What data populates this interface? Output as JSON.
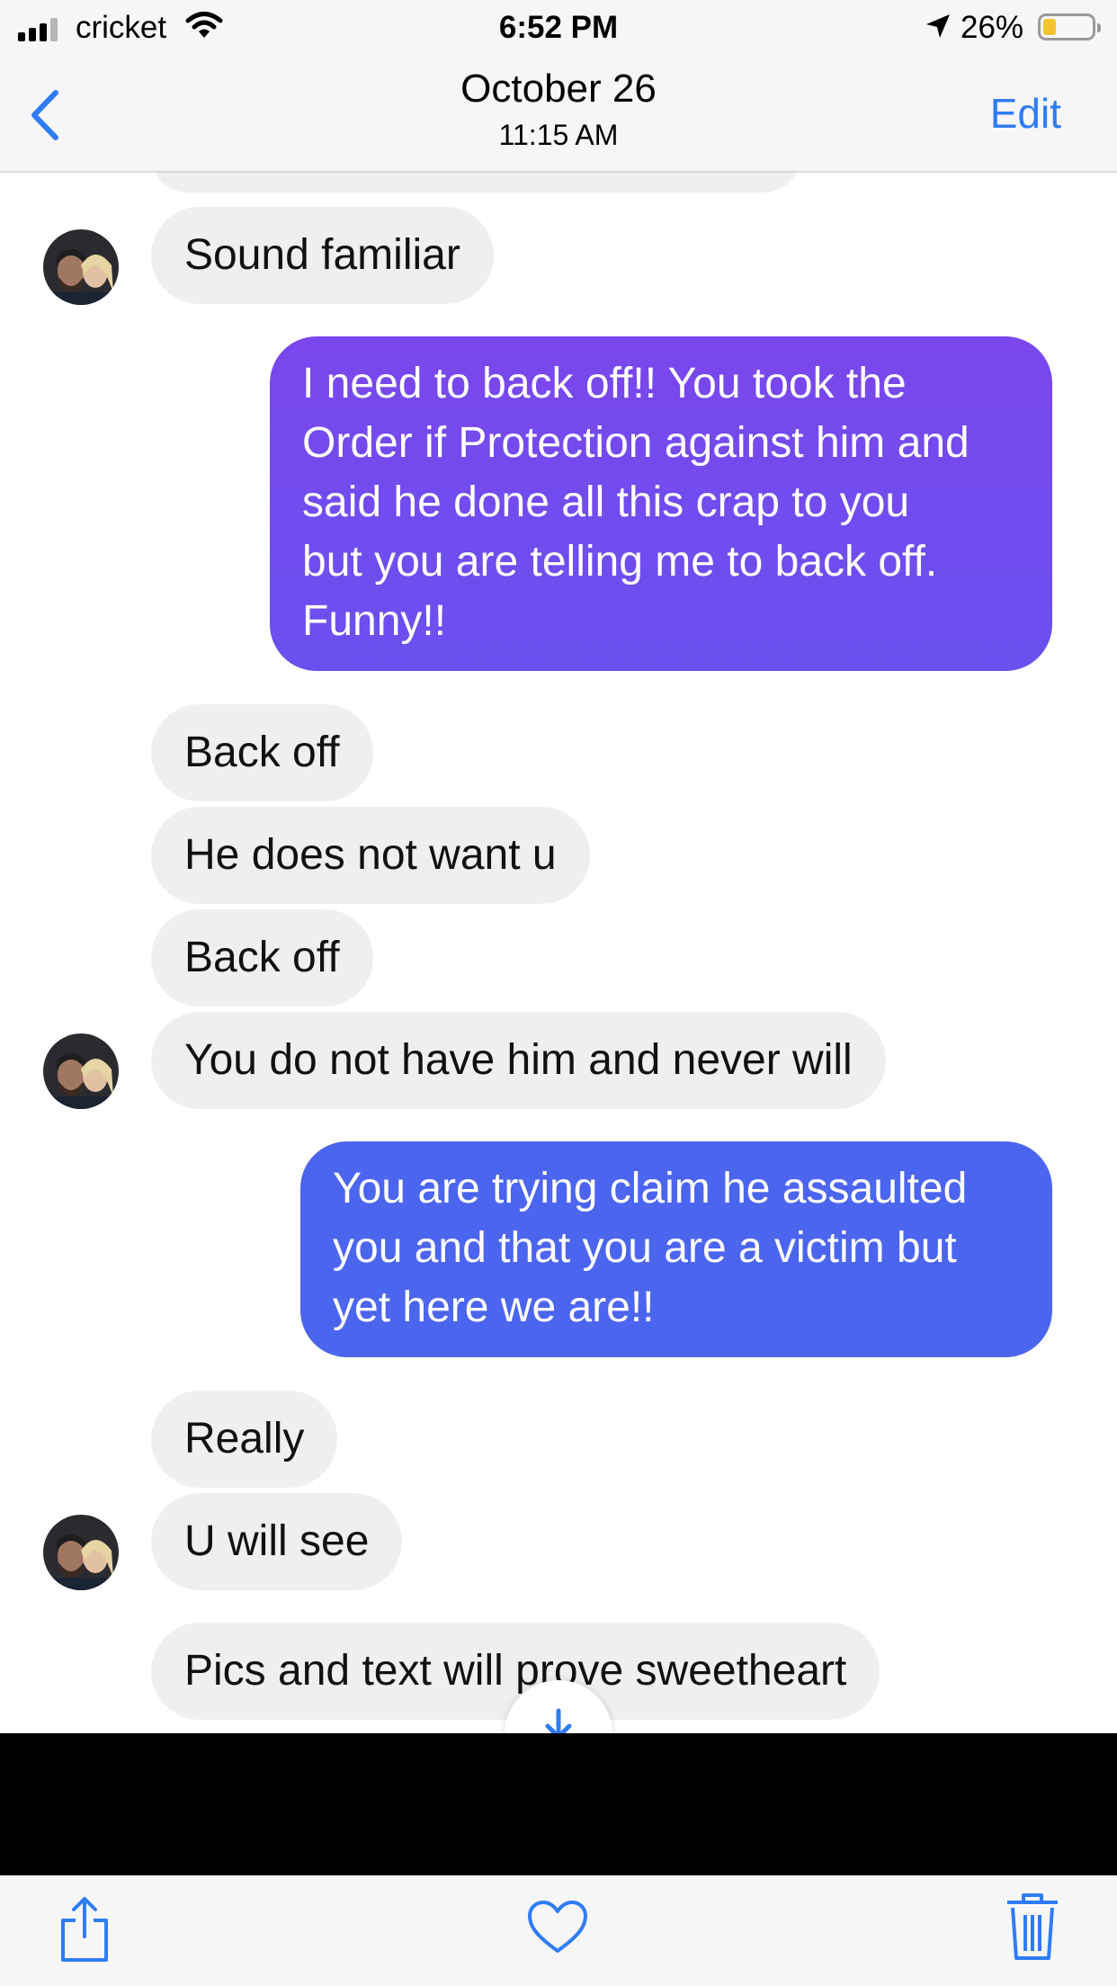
{
  "status_bar": {
    "carrier": "cricket",
    "time": "6:52 PM",
    "battery_percent": "26%",
    "battery_level": 0.26,
    "battery_color": "#f4c430"
  },
  "nav": {
    "date": "October 26",
    "time": "11:15 AM",
    "edit_label": "Edit",
    "back_icon": "chevron-left-icon",
    "accent_color": "#2f7cf6"
  },
  "messages": [
    {
      "side": "incoming",
      "text": "Sound familiar"
    },
    {
      "side": "outgoing",
      "lines": [
        "I need to back off!! You took the",
        "Order if Protection against him and",
        "said he done all this crap to you",
        "but you are telling me to back off.",
        "Funny!!"
      ]
    },
    {
      "side": "incoming",
      "text": "Back off"
    },
    {
      "side": "incoming",
      "text": "He does not want u"
    },
    {
      "side": "incoming",
      "text": "Back off"
    },
    {
      "side": "incoming",
      "text": "You do not have him and never will"
    },
    {
      "side": "outgoing",
      "lines": [
        "You are trying claim he assaulted",
        "you and that you are a victim but",
        "yet here we are!!"
      ]
    },
    {
      "side": "incoming",
      "text": "Really"
    },
    {
      "side": "incoming",
      "text": "U will see"
    },
    {
      "side": "incoming",
      "text": "Pics and text will prove sweetheart"
    }
  ],
  "colors": {
    "incoming_bubble": "#efefef",
    "outgoing_bubble_1": "#6d4bee",
    "outgoing_bubble_2": "#4c65ee"
  },
  "toolbar": {
    "icons": [
      "share-icon",
      "heart-icon",
      "trash-icon"
    ]
  }
}
